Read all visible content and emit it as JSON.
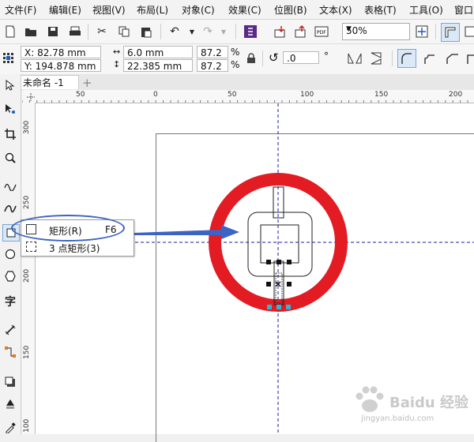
{
  "menu": [
    "文件(F)",
    "编辑(E)",
    "视图(V)",
    "布局(L)",
    "对象(C)",
    "效果(C)",
    "位图(B)",
    "文本(X)",
    "表格(T)",
    "工具(O)",
    "窗口"
  ],
  "toolbar": {
    "zoom": "50%"
  },
  "properties": {
    "x": "X: 82.78 mm",
    "y": "Y: 194.878 mm",
    "width": "6.0 mm",
    "height": "22.385 mm",
    "scale_w": "87.2",
    "scale_h": "87.2",
    "percent": "%",
    "angle": ".0",
    "degree": "°"
  },
  "document": {
    "tab": "未命名 -1"
  },
  "ruler": {
    "h_labels": [
      "50",
      "0",
      "50",
      "100",
      "150",
      "200"
    ],
    "v_labels": [
      "300",
      "250",
      "200",
      "150",
      "100"
    ]
  },
  "flyout": {
    "items": [
      {
        "label": "矩形(R)",
        "shortcut": "F6"
      },
      {
        "label": "3 点矩形(3)",
        "shortcut": ""
      }
    ]
  },
  "watermark": {
    "text": "Baidu 经验",
    "url": "jingyan.baidu.com"
  },
  "colors": {
    "ring": "#e31b23",
    "arrow": "#3d63c4",
    "guide": "#1b1baa",
    "handle_cyan": "#2bb7d6"
  }
}
